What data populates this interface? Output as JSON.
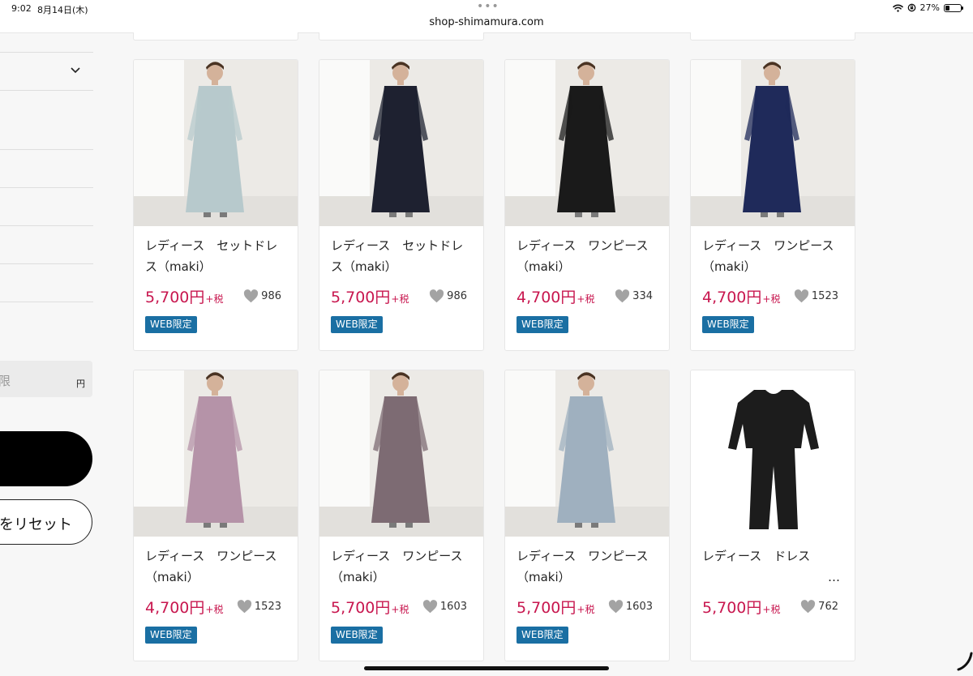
{
  "status_bar": {
    "time": "9:02",
    "date": "8月14日(木)",
    "url": "shop-shimamura.com",
    "battery": "27%",
    "battery_level": 0.27
  },
  "sidebar": {
    "price_placeholder": "限",
    "price_unit": "円",
    "reset_label": "をリセット"
  },
  "colors": {
    "price": "#c8174f",
    "badge": "#1a6fa3",
    "heart": "#a3a3a3"
  },
  "products": [
    {
      "name": "レディース　セットドレス（maki）",
      "price": "5,700円",
      "tax": "+税",
      "likes": "986",
      "badge": "WEB限定",
      "dress_color": "#b7c9cc"
    },
    {
      "name": "レディース　セットドレス（maki）",
      "price": "5,700円",
      "tax": "+税",
      "likes": "986",
      "badge": "WEB限定",
      "dress_color": "#1e2130"
    },
    {
      "name": "レディース　ワンピース（maki）",
      "price": "4,700円",
      "tax": "+税",
      "likes": "334",
      "badge": "WEB限定",
      "dress_color": "#1a1a1a"
    },
    {
      "name": "レディース　ワンピース（maki）",
      "price": "4,700円",
      "tax": "+税",
      "likes": "1523",
      "badge": "WEB限定",
      "dress_color": "#1f2a5a"
    },
    {
      "name": "レディース　ワンピース（maki）",
      "price": "4,700円",
      "tax": "+税",
      "likes": "1523",
      "badge": "WEB限定",
      "dress_color": "#b593a8"
    },
    {
      "name": "レディース　ワンピース（maki）",
      "price": "5,700円",
      "tax": "+税",
      "likes": "1603",
      "badge": "WEB限定",
      "dress_color": "#7d6b73"
    },
    {
      "name": "レディース　ワンピース（maki）",
      "price": "5,700円",
      "tax": "+税",
      "likes": "1603",
      "badge": "WEB限定",
      "dress_color": "#9fb0bf"
    },
    {
      "name": "レディース　ドレス",
      "name_more": "…",
      "price": "5,700円",
      "tax": "+税",
      "likes": "762",
      "dress_color": "#1c1c1c"
    }
  ]
}
